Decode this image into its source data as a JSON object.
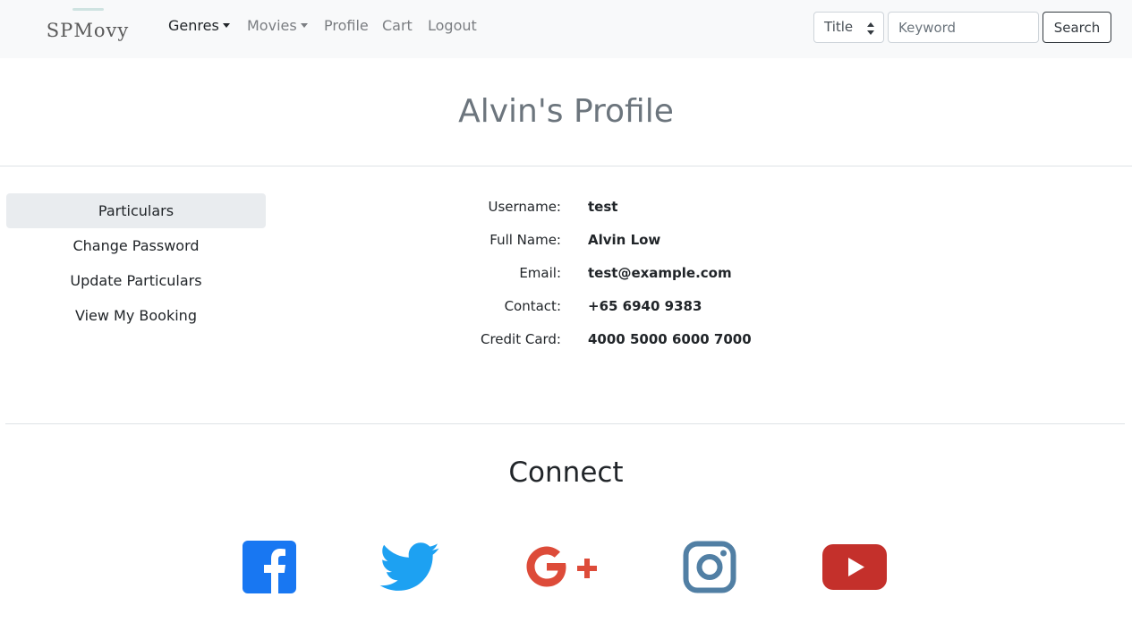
{
  "navbar": {
    "brand": "SPMovy",
    "items": [
      {
        "label": "Genres",
        "dropdown": true
      },
      {
        "label": "Movies",
        "dropdown": true
      },
      {
        "label": "Profile"
      },
      {
        "label": "Cart"
      },
      {
        "label": "Logout"
      }
    ],
    "search": {
      "select_value": "Title",
      "placeholder": "Keyword",
      "button_label": "Search"
    }
  },
  "page": {
    "title": "Alvin's Profile"
  },
  "sidebar": {
    "items": [
      {
        "label": "Particulars",
        "active": true
      },
      {
        "label": "Change Password"
      },
      {
        "label": "Update Particulars"
      },
      {
        "label": "View My Booking"
      }
    ]
  },
  "details": [
    {
      "label": "Username:",
      "value": "test"
    },
    {
      "label": "Full Name:",
      "value": "Alvin Low"
    },
    {
      "label": "Email:",
      "value": "test@example.com"
    },
    {
      "label": "Contact:",
      "value": "+65 6940 9383"
    },
    {
      "label": "Credit Card:",
      "value": "4000 5000 6000 7000"
    }
  ],
  "connect": {
    "title": "Connect",
    "icons": [
      {
        "name": "facebook-icon",
        "color": "#1877f2"
      },
      {
        "name": "twitter-icon",
        "color": "#1da1f2"
      },
      {
        "name": "google-plus-icon",
        "color": "#dd4b39"
      },
      {
        "name": "instagram-icon",
        "color": "#517fa4"
      },
      {
        "name": "youtube-icon",
        "color": "#c4302b"
      }
    ]
  }
}
